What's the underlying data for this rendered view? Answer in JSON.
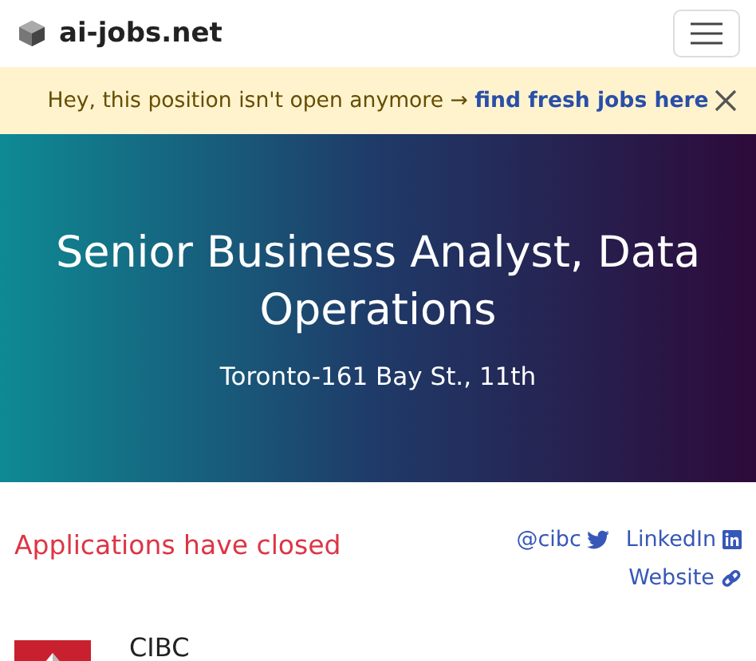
{
  "navbar": {
    "brand": "ai-jobs.net"
  },
  "notice": {
    "text": "Hey, this position isn't open anymore →",
    "link": "find fresh jobs here"
  },
  "hero": {
    "title": "Senior Business Analyst, Data Operations",
    "location": "Toronto-161 Bay St., 11th"
  },
  "status": "Applications have closed",
  "social_links": [
    {
      "kind": "twitter",
      "label": "@cibc"
    },
    {
      "kind": "linkedin",
      "label": "LinkedIn"
    },
    {
      "kind": "website",
      "label": "Website"
    }
  ],
  "company": {
    "name": "CIBC"
  }
}
